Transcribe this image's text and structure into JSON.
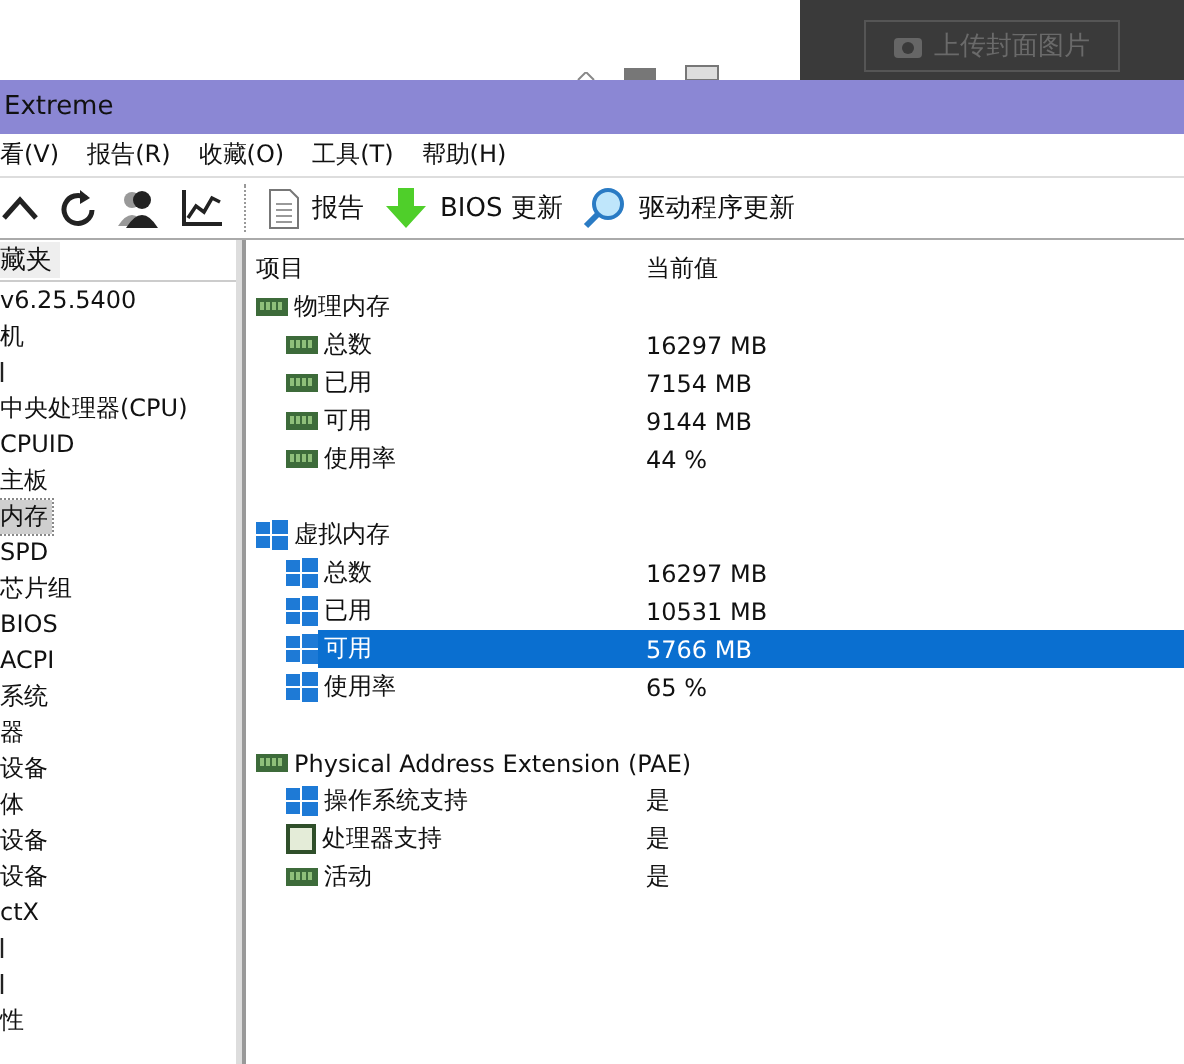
{
  "background_page": {
    "upload_button": "上传封面图片"
  },
  "window": {
    "title": "Extreme"
  },
  "menu": [
    "看(V)",
    "报告(R)",
    "收藏(O)",
    "工具(T)",
    "帮助(H)"
  ],
  "toolbar": [
    {
      "kind": "up"
    },
    {
      "kind": "refresh"
    },
    {
      "kind": "user"
    },
    {
      "kind": "chart"
    },
    {
      "kind": "report",
      "label": "报告"
    },
    {
      "kind": "bios",
      "label": "BIOS 更新"
    },
    {
      "kind": "driver",
      "label": "驱动程序更新"
    }
  ],
  "sidebar": {
    "tab": "藏夹",
    "items": [
      {
        "kind": "item",
        "label": "v6.25.5400",
        "selected": false
      },
      {
        "kind": "item",
        "label": "机",
        "selected": false
      },
      {
        "kind": "clipped"
      },
      {
        "kind": "item",
        "label": "中央处理器(CPU)",
        "selected": false
      },
      {
        "kind": "item",
        "label": "CPUID",
        "selected": false
      },
      {
        "kind": "item",
        "label": "主板",
        "selected": false
      },
      {
        "kind": "item",
        "label": "内存",
        "selected": true
      },
      {
        "kind": "item",
        "label": "SPD",
        "selected": false
      },
      {
        "kind": "item",
        "label": "芯片组",
        "selected": false
      },
      {
        "kind": "item",
        "label": "BIOS",
        "selected": false
      },
      {
        "kind": "item",
        "label": "ACPI",
        "selected": false
      },
      {
        "kind": "item",
        "label": "系统",
        "selected": false
      },
      {
        "kind": "item",
        "label": "器",
        "selected": false
      },
      {
        "kind": "item",
        "label": "设备",
        "selected": false
      },
      {
        "kind": "item",
        "label": "体",
        "selected": false
      },
      {
        "kind": "item",
        "label": "设备",
        "selected": false
      },
      {
        "kind": "item",
        "label": "设备",
        "selected": false
      },
      {
        "kind": "item",
        "label": "ctX",
        "selected": false
      },
      {
        "kind": "clipped"
      },
      {
        "kind": "clipped"
      },
      {
        "kind": "item",
        "label": "性",
        "selected": false
      }
    ]
  },
  "table": {
    "columns": [
      "项目",
      "当前值"
    ],
    "groups": [
      {
        "title": "物理内存",
        "kind": "ram",
        "rows": [
          {
            "label": "总数",
            "value": "16297 MB",
            "kind": "ram",
            "selected": false
          },
          {
            "label": "已用",
            "value": "7154 MB",
            "kind": "ram",
            "selected": false
          },
          {
            "label": "可用",
            "value": "9144 MB",
            "kind": "ram",
            "selected": false
          },
          {
            "label": "使用率",
            "value": "44 %",
            "kind": "ram",
            "selected": false
          }
        ]
      },
      {
        "title": "虚拟内存",
        "kind": "windows",
        "rows": [
          {
            "label": "总数",
            "value": "16297 MB",
            "kind": "windows",
            "selected": false
          },
          {
            "label": "已用",
            "value": "10531 MB",
            "kind": "windows",
            "selected": false
          },
          {
            "label": "可用",
            "value": "5766 MB",
            "kind": "windows",
            "selected": true
          },
          {
            "label": "使用率",
            "value": "65 %",
            "kind": "windows",
            "selected": false
          }
        ]
      },
      {
        "title": "Physical Address Extension (PAE)",
        "kind": "ram",
        "rows": [
          {
            "label": "操作系统支持",
            "value": "是",
            "kind": "windows",
            "selected": false
          },
          {
            "label": "处理器支持",
            "value": "是",
            "kind": "chip",
            "selected": false
          },
          {
            "label": "活动",
            "value": "是",
            "kind": "ram",
            "selected": false
          }
        ]
      }
    ]
  }
}
